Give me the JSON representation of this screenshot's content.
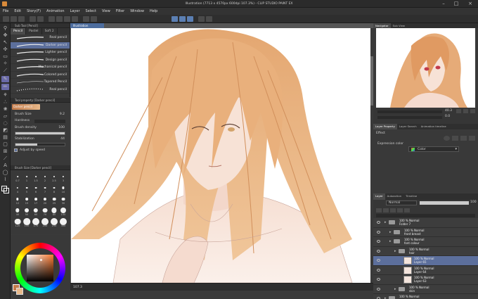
{
  "window": {
    "title": "Illustration (7713 x 4570px 600dpi 107.3%) - CLIP STUDIO PAINT EX"
  },
  "menu": [
    "File",
    "Edit",
    "Story(F)",
    "Animation",
    "Layer",
    "Select",
    "View",
    "Filter",
    "Window",
    "Help"
  ],
  "subtool_panel": {
    "header": "Sub Tool [Pencil]",
    "tabs": [
      "Pencil",
      "Pastel",
      "Soft 2"
    ],
    "brushes": [
      {
        "label": "Real pencil",
        "active": false
      },
      {
        "label": "Darker pencil",
        "active": true
      },
      {
        "label": "Lighter pencil",
        "active": false
      },
      {
        "label": "Design pencil",
        "active": false
      },
      {
        "label": "Mechanical pencil",
        "active": false
      },
      {
        "label": "Colored pencil",
        "active": false
      },
      {
        "label": "Tapered Pencil",
        "active": false
      },
      {
        "label": "Real pencil",
        "active": false
      }
    ]
  },
  "tool_property": {
    "header": "Tool property [Darker pencil]",
    "selected": "Darker pencil",
    "brush_size_label": "Brush Size",
    "brush_size_value": "9.2",
    "hardness_label": "Hardness",
    "brush_density_label": "Brush density",
    "brush_density_value": "100",
    "brush_density_fraction": 1.0,
    "stabilization_label": "Stabilization",
    "stabilization_value": "44",
    "stabilization_fraction": 0.44,
    "adjust_label": "Adjust by speed",
    "adjust_checked": true
  },
  "brush_size_panel": {
    "header": "Brush Size [Darker pencil]",
    "sizes": [
      "0.7",
      "1",
      "1.5",
      "2",
      "2.5",
      "3",
      "4",
      "5",
      "6",
      "7",
      "8",
      "10",
      "12",
      "15",
      "17",
      "20",
      "25",
      "30",
      "40",
      "50",
      "60",
      "70",
      "80",
      "100",
      "120",
      "150",
      "170",
      "200",
      "250",
      "300"
    ]
  },
  "canvas": {
    "tab_label": "Illustration",
    "status": "107.3"
  },
  "navigator": {
    "tabs": [
      "Navigator",
      "Sub View"
    ],
    "zoom_value": "40.3",
    "rotation_value": "0.0"
  },
  "layer_property": {
    "tabs": [
      "Layer Property",
      "Layer Search",
      "Animation timeline"
    ],
    "effect_label": "Effect",
    "expression_color_label": "Expression color",
    "expression_color_value": "Color"
  },
  "layer_panel": {
    "tabs": [
      "Layer",
      "Autoaction",
      "Timeline"
    ],
    "blend_mode": "Normal",
    "opacity": "100",
    "layers": [
      {
        "mode": "100 % Normal",
        "name": "Folder 7",
        "type": "folder",
        "indent": 0,
        "active": false
      },
      {
        "mode": "100 % Normal",
        "name": "front breast",
        "type": "folder",
        "indent": 1,
        "active": false
      },
      {
        "mode": "100 % Normal",
        "name": "font colour",
        "type": "folder",
        "indent": 1,
        "active": false
      },
      {
        "mode": "100 % Normal",
        "name": "hair",
        "type": "folder",
        "indent": 2,
        "active": false
      },
      {
        "mode": "100 % Normal",
        "name": "Layer 65",
        "type": "layer",
        "indent": 3,
        "active": true
      },
      {
        "mode": "100 % Normal",
        "name": "Layer 64",
        "type": "layer",
        "indent": 3,
        "active": false
      },
      {
        "mode": "100 % Normal",
        "name": "Layer 63",
        "type": "layer",
        "indent": 3,
        "active": false
      },
      {
        "mode": "100 % Normal",
        "name": "skin",
        "type": "folder",
        "indent": 2,
        "active": false
      },
      {
        "mode": "100 % Normal",
        "name": "",
        "type": "folder",
        "indent": 0,
        "active": false
      }
    ]
  },
  "colors": {
    "main_color": "#c27a4a",
    "sub_color": "#e8b98a",
    "accent": "#5c6f9c"
  }
}
